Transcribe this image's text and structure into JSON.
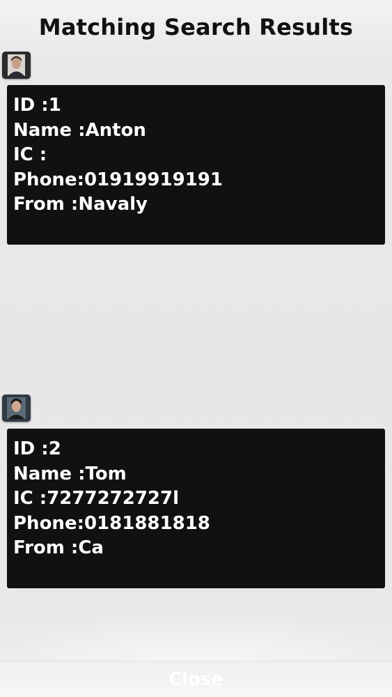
{
  "header": {
    "title": "Matching Search Results"
  },
  "results": [
    {
      "avatar_icon": "person-photo-icon",
      "lines": [
        "ID :1",
        "Name :Anton",
        "IC :",
        "Phone:01919919191",
        "From :Navaly"
      ]
    },
    {
      "avatar_icon": "person-photo-icon",
      "lines": [
        "ID :2",
        "Name :Tom",
        "IC :7277272727l",
        "Phone:0181881818",
        "From :Ca"
      ]
    }
  ],
  "footer": {
    "close_label": "Close"
  },
  "colors": {
    "card_bg": "#111111",
    "card_text": "#ffffff",
    "background": "#e8e8ea",
    "title": "#111111"
  }
}
